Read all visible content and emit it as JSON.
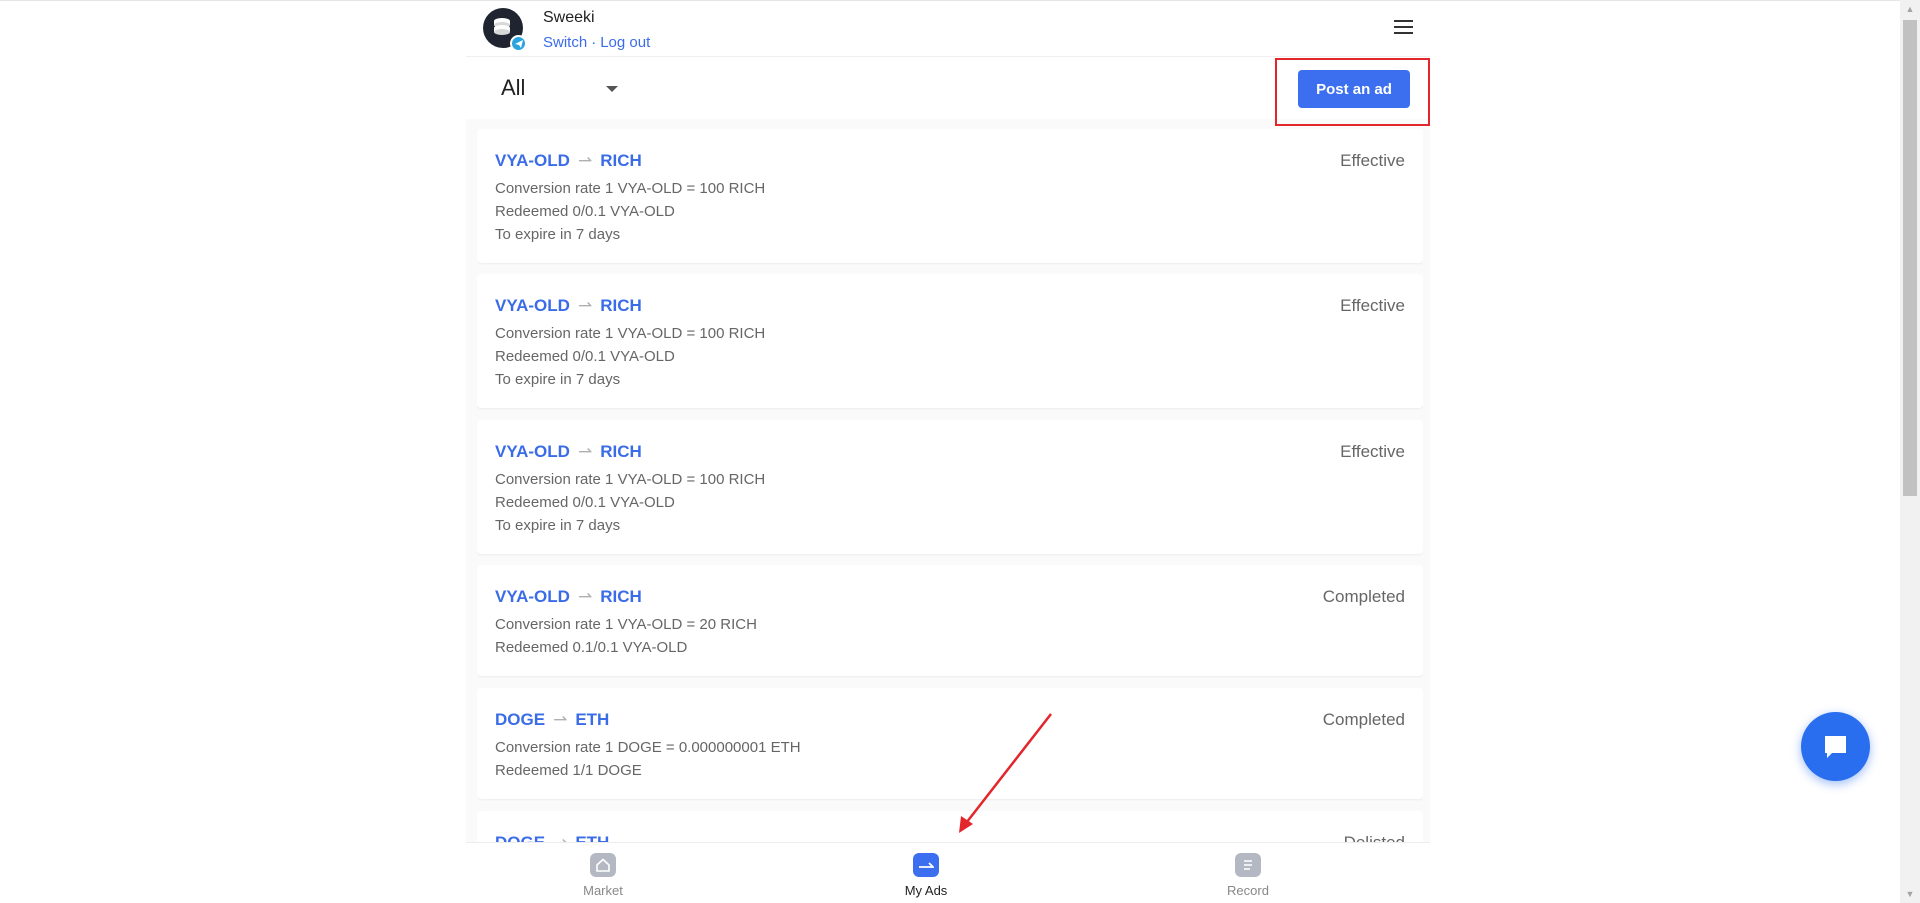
{
  "header": {
    "user_name": "Sweeki",
    "switch_label": "Switch",
    "separator": "·",
    "logout_label": "Log out"
  },
  "filter": {
    "selected": "All"
  },
  "toolbar": {
    "post_label": "Post an ad"
  },
  "ads": [
    {
      "from": "VYA-OLD",
      "to": "RICH",
      "status": "Effective",
      "rate": "Conversion rate 1 VYA-OLD = 100 RICH",
      "redeemed": "Redeemed 0/0.1 VYA-OLD",
      "expire": "To expire in 7 days"
    },
    {
      "from": "VYA-OLD",
      "to": "RICH",
      "status": "Effective",
      "rate": "Conversion rate 1 VYA-OLD = 100 RICH",
      "redeemed": "Redeemed 0/0.1 VYA-OLD",
      "expire": "To expire in 7 days"
    },
    {
      "from": "VYA-OLD",
      "to": "RICH",
      "status": "Effective",
      "rate": "Conversion rate 1 VYA-OLD = 100 RICH",
      "redeemed": "Redeemed 0/0.1 VYA-OLD",
      "expire": "To expire in 7 days"
    },
    {
      "from": "VYA-OLD",
      "to": "RICH",
      "status": "Completed",
      "rate": "Conversion rate 1 VYA-OLD = 20 RICH",
      "redeemed": "Redeemed 0.1/0.1 VYA-OLD"
    },
    {
      "from": "DOGE",
      "to": "ETH",
      "status": "Completed",
      "rate": "Conversion rate 1 DOGE = 0.000000001 ETH",
      "redeemed": "Redeemed 1/1 DOGE"
    },
    {
      "from": "DOGE",
      "to": "ETH",
      "status": "Delisted"
    }
  ],
  "nav": {
    "market": "Market",
    "my_ads": "My Ads",
    "record": "Record"
  },
  "colors": {
    "accent": "#3b6ff0",
    "link": "#3b6ce8",
    "highlight": "#e3262b"
  }
}
